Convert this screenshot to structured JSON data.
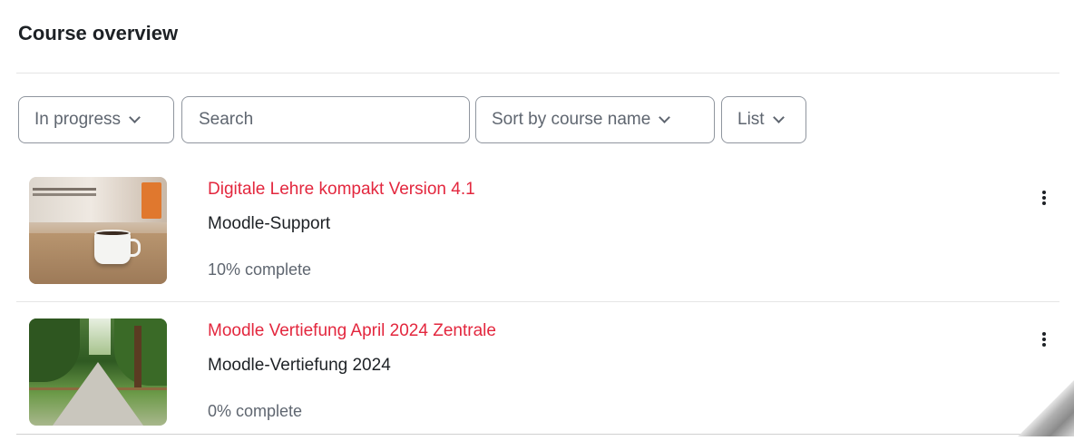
{
  "block": {
    "title": "Course overview"
  },
  "filters": {
    "grouping": {
      "label": "In progress"
    },
    "search": {
      "placeholder": "Search",
      "value": ""
    },
    "sort": {
      "label": "Sort by course name"
    },
    "view": {
      "label": "List"
    }
  },
  "courses": [
    {
      "name": "Digitale Lehre kompakt Version 4.1",
      "category": "Moodle-Support",
      "progress_text": "10% complete",
      "progress": 10,
      "image_icon": "coffee-cup-image"
    },
    {
      "name": "Moodle Vertiefung April 2024 Zentrale",
      "category": "Moodle-Vertiefung 2024",
      "progress_text": "0% complete",
      "progress": 0,
      "image_icon": "park-path-image"
    }
  ],
  "colors": {
    "course_link": "#e3273e",
    "text": "#1d2125",
    "muted": "#5f6670",
    "border": "#8f959e"
  },
  "icons": {
    "dropdown": "chevron-down-icon",
    "course_menu": "vertical-ellipsis-icon"
  }
}
